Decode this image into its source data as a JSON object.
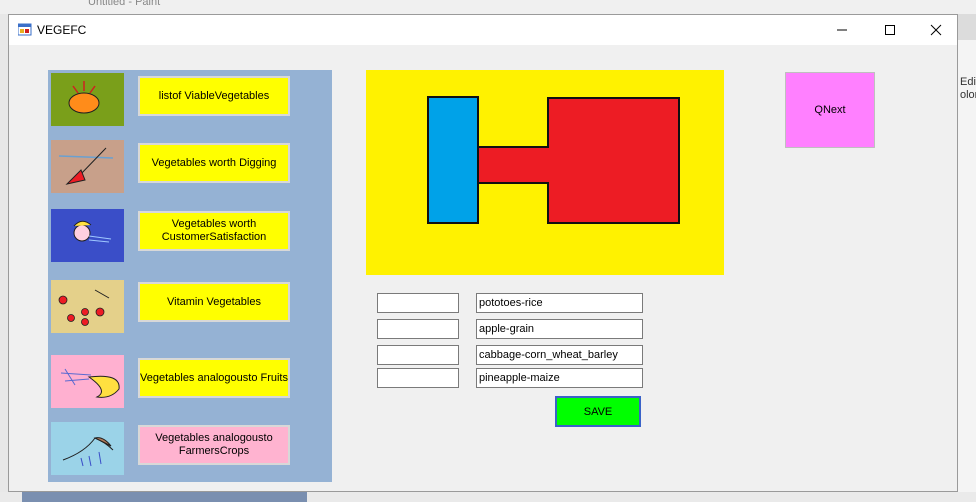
{
  "background": {
    "app_title": "Untitled - Paint",
    "right_text_1": "Edit",
    "right_text_2": "olor"
  },
  "window": {
    "title": "VEGEFC",
    "controls": {
      "minimize": "minimize-icon",
      "maximize": "maximize-icon",
      "close": "close-icon"
    }
  },
  "menu": {
    "items": [
      {
        "label": "listof ViableVegetables",
        "thumb_bg": "#7a9f1a"
      },
      {
        "label": "Vegetables worth Digging",
        "thumb_bg": "#c8a08a"
      },
      {
        "label": "Vegetables worth CustomerSatisfaction",
        "thumb_bg": "#3a4ec8"
      },
      {
        "label": "Vitamin Vegetables",
        "thumb_bg": "#e4d08a"
      },
      {
        "label": "Vegetables analogousto Fruits",
        "thumb_bg": "#ffb0d0"
      },
      {
        "label": "Vegetables analogousto FarmersCrops",
        "thumb_bg": "#9bd3e8"
      }
    ]
  },
  "canvas": {
    "background": "#fff200",
    "blue": "#00a2e8",
    "red": "#ed1c24"
  },
  "buttons": {
    "next": "QNext",
    "save": "SAVE"
  },
  "fields": {
    "short": [
      "",
      "",
      "",
      ""
    ],
    "long": [
      "pototoes-rice",
      "apple-grain",
      "cabbage-corn_wheat_barley",
      "pineapple-maize"
    ]
  }
}
